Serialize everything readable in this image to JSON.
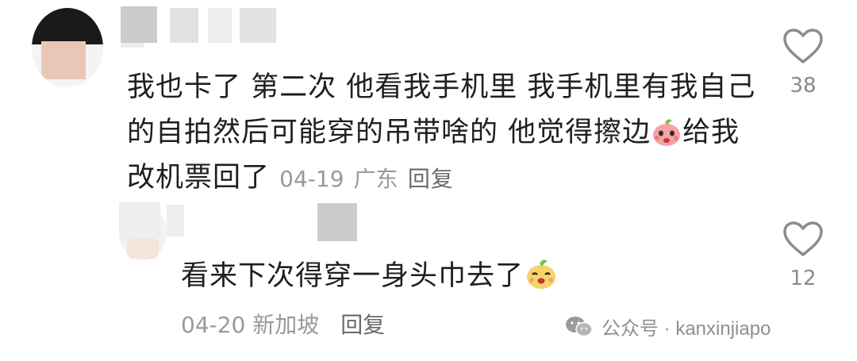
{
  "comment1": {
    "text": "我也卡了 第二次 他看我手机里 我手机里有我自己的自拍然后可能穿的吊带啥的 他觉得擦边",
    "text_after_emoji": "给我改机票回了",
    "date": "04-19",
    "location": "广东",
    "reply_label": "回复",
    "likes": "38"
  },
  "comment2": {
    "text": "看来下次得穿一身头巾去了",
    "date": "04-20",
    "location": "新加坡",
    "reply_label": "回复",
    "likes": "12"
  },
  "watermark": {
    "prefix": "公众号 · ",
    "account": "kanxinjiapo"
  },
  "colors": {
    "text": "#1f1f1f",
    "meta": "#999999",
    "heart": "#8c8c8c"
  }
}
